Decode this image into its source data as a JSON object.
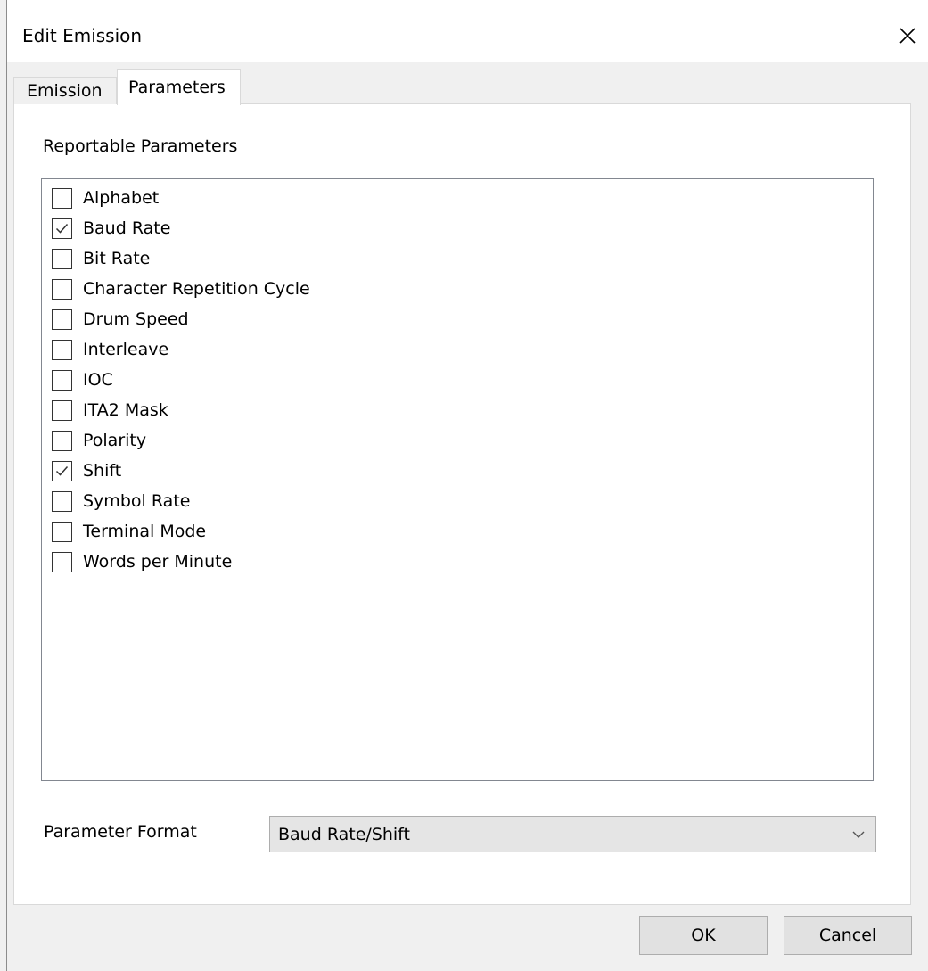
{
  "window": {
    "title": "Edit Emission"
  },
  "tabs": [
    {
      "label": "Emission",
      "selected": false
    },
    {
      "label": "Parameters",
      "selected": true
    }
  ],
  "parameters": {
    "section_label": "Reportable Parameters",
    "items": [
      {
        "label": "Alphabet",
        "checked": false
      },
      {
        "label": "Baud Rate",
        "checked": true
      },
      {
        "label": "Bit Rate",
        "checked": false
      },
      {
        "label": "Character Repetition Cycle",
        "checked": false
      },
      {
        "label": "Drum Speed",
        "checked": false
      },
      {
        "label": "Interleave",
        "checked": false
      },
      {
        "label": "IOC",
        "checked": false
      },
      {
        "label": "ITA2 Mask",
        "checked": false
      },
      {
        "label": "Polarity",
        "checked": false
      },
      {
        "label": "Shift",
        "checked": true
      },
      {
        "label": "Symbol Rate",
        "checked": false
      },
      {
        "label": "Terminal Mode",
        "checked": false
      },
      {
        "label": "Words per Minute",
        "checked": false
      }
    ]
  },
  "format": {
    "label": "Parameter Format",
    "selected": "Baud Rate/Shift"
  },
  "buttons": {
    "ok": "OK",
    "cancel": "Cancel"
  },
  "icons": {
    "close": "close-icon",
    "check": "check-icon",
    "dropdown": "chevron-down-icon"
  }
}
